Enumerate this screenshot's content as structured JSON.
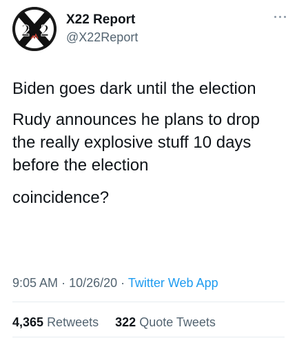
{
  "author": {
    "display_name": "X22 Report",
    "handle": "@X22Report",
    "avatar_text": "2X2"
  },
  "more_icon": "more-horizontal-icon",
  "tweet": {
    "paragraphs": [
      "Biden goes dark until the election",
      "Rudy announces he plans to drop the really explosive stuff 10 days before the election",
      "coincidence?"
    ]
  },
  "meta": {
    "time": "9:05 AM",
    "separator": "·",
    "date": "10/26/20",
    "source": "Twitter Web App"
  },
  "stats": {
    "retweets_count": "4,365",
    "retweets_label": "Retweets",
    "quotes_count": "322",
    "quotes_label": "Quote Tweets"
  },
  "colors": {
    "text": "#0f1419",
    "secondary": "#536471",
    "link": "#1d9bf0",
    "divider": "#e6ecf0"
  }
}
